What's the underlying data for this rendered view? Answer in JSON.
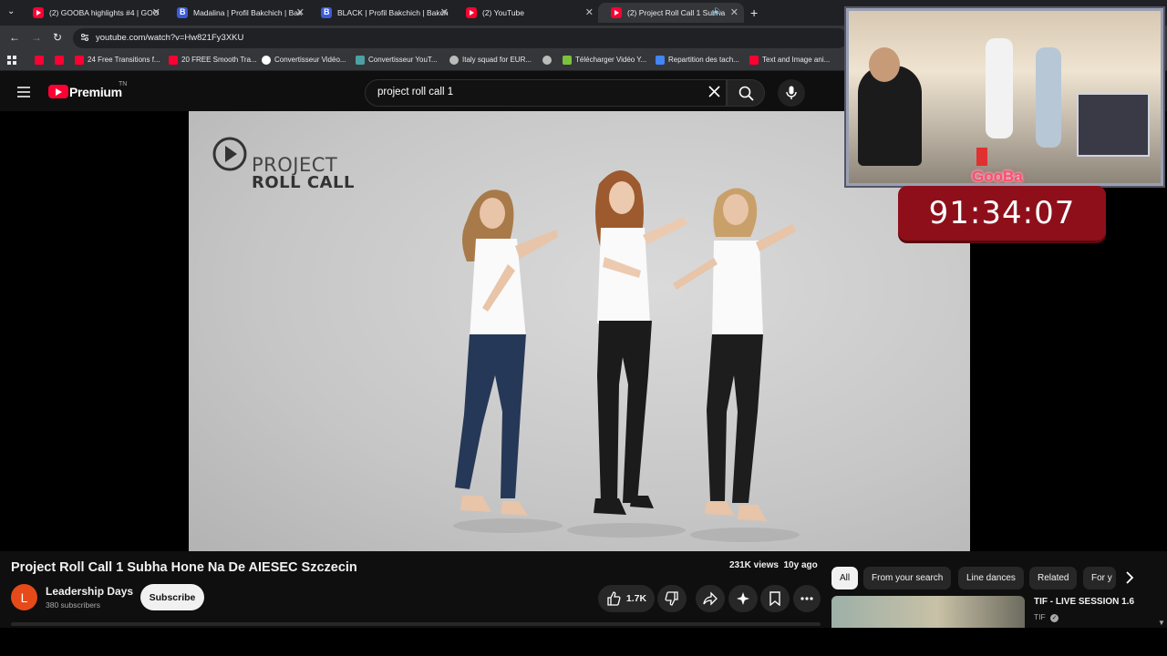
{
  "browser": {
    "tabs": [
      {
        "title": "(2) GOOBA highlights #4 | GOO",
        "favicon": "youtube-icon"
      },
      {
        "title": "Madalina | Profil Bakchich | Bak",
        "favicon": "bakchich-icon"
      },
      {
        "title": "BLACK | Profil Bakchich | Bakch",
        "favicon": "bakchich-icon"
      },
      {
        "title": "(2) YouTube",
        "favicon": "youtube-icon"
      },
      {
        "title": "(2) Project Roll Call 1 Subha",
        "favicon": "youtube-icon",
        "active": true
      }
    ],
    "url": "youtube.com/watch?v=Hw821Fy3XKU",
    "bookmarks": [
      {
        "label": "",
        "icon": "youtube-icon"
      },
      {
        "label": "",
        "icon": "youtube-icon"
      },
      {
        "label": "24 Free Transitions f...",
        "icon": "youtube-icon"
      },
      {
        "label": "20 FREE Smooth Tra...",
        "icon": "youtube-icon"
      },
      {
        "label": "Convertisseur Vidéo...",
        "icon": "google-icon"
      },
      {
        "label": "Convertisseur YouT...",
        "icon": "converter-icon"
      },
      {
        "label": "Italy squad for EUR...",
        "icon": "globe-icon"
      },
      {
        "label": "",
        "icon": "globe-icon"
      },
      {
        "label": "Télécharger Vidéo Y...",
        "icon": "download-icon"
      },
      {
        "label": "Repartition des tach...",
        "icon": "docs-icon"
      },
      {
        "label": "Text and Image ani...",
        "icon": "youtube-icon"
      }
    ]
  },
  "youtube": {
    "logo_text": "Premium",
    "region": "TN",
    "search_query": "project roll call 1"
  },
  "video": {
    "brand_line1": "PROJECT",
    "brand_line2": "ROLL CALL",
    "title": "Project Roll Call 1 Subha Hone Na De AIESEC Szczecin",
    "views": "231K views",
    "age": "10y ago",
    "likes": "1.7K",
    "channel": {
      "name": "Leadership Days",
      "initial": "L",
      "subscribers": "380 subscribers"
    },
    "subscribe_label": "Subscribe"
  },
  "overlay": {
    "streamer_tag": "GooBa",
    "timer": "91:34:07"
  },
  "chips": [
    "All",
    "From your search",
    "Line dances",
    "Related",
    "For y"
  ],
  "recommendation": {
    "title": "TIF - LIVE SESSION 1.6",
    "channel": "TIF"
  },
  "colors": {
    "accent_red": "#ff0033",
    "timer_bg": "#8e0f1a",
    "page_bg": "#0f0f0f"
  }
}
